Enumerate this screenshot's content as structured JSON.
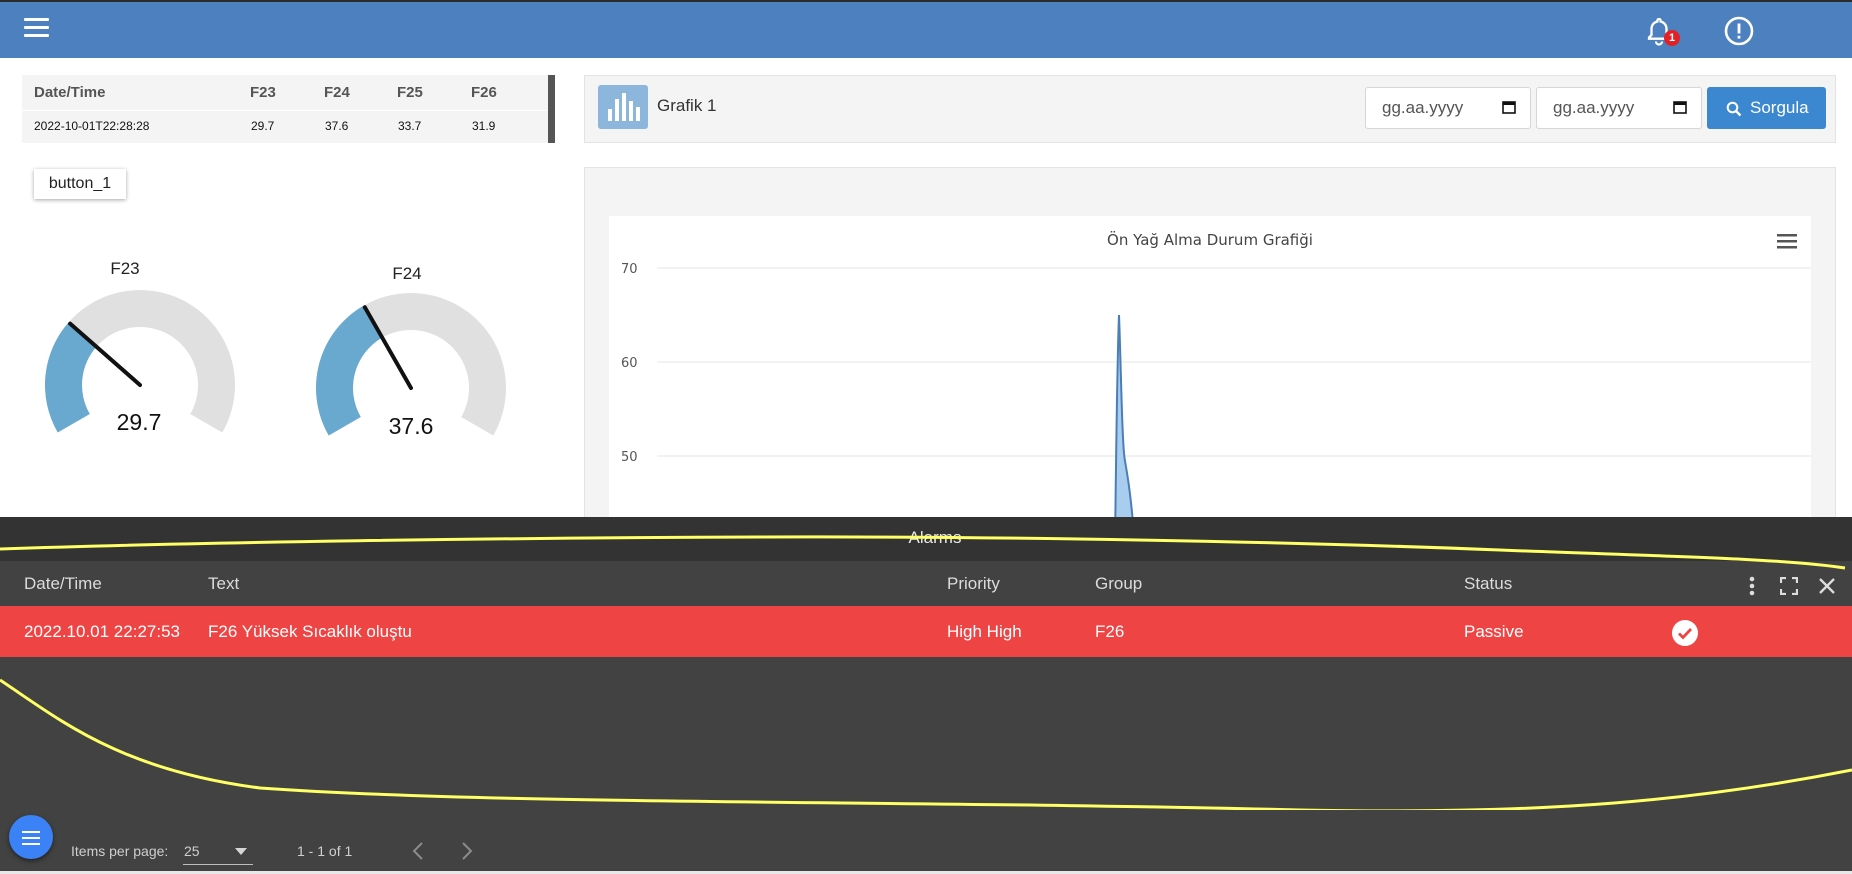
{
  "topbar": {
    "notification_count": "1",
    "accent_color": "#4d80be"
  },
  "data_table": {
    "columns": [
      "Date/Time",
      "F23",
      "F24",
      "F25",
      "F26"
    ],
    "rows": [
      [
        "2022-10-01T22:28:28",
        "29.7",
        "37.6",
        "33.7",
        "31.9"
      ]
    ]
  },
  "button_1": {
    "label": "button_1"
  },
  "gauges": [
    {
      "title": "F23",
      "value": "29.7",
      "fraction": 0.297
    },
    {
      "title": "F24",
      "value": "37.6",
      "fraction": 0.376
    }
  ],
  "chart_panel": {
    "title": "Grafik 1",
    "date_from_placeholder": "gg.aa.yyyy",
    "date_to_placeholder": "gg.aa.yyyy",
    "query_button": "Sorgula"
  },
  "chart_data": {
    "type": "area",
    "title": "Ön Yağ Alma Durum Grafiği",
    "y_ticks": [
      "70",
      "60",
      "50"
    ],
    "ylim": [
      40,
      70
    ],
    "peak_value": 65
  },
  "alarms": {
    "title": "Alarms",
    "columns": [
      "Date/Time",
      "Text",
      "Priority",
      "Group",
      "Status"
    ],
    "rows": [
      {
        "datetime": "2022.10.01 22:27:53",
        "text": "F26 Yüksek Sıcaklık oluştu",
        "priority": "High High",
        "group": "F26",
        "status": "Passive"
      }
    ],
    "row_color": "#ef4444",
    "items_per_page_label": "Items per page:",
    "items_per_page": "25",
    "range": "1 - 1 of 1"
  }
}
